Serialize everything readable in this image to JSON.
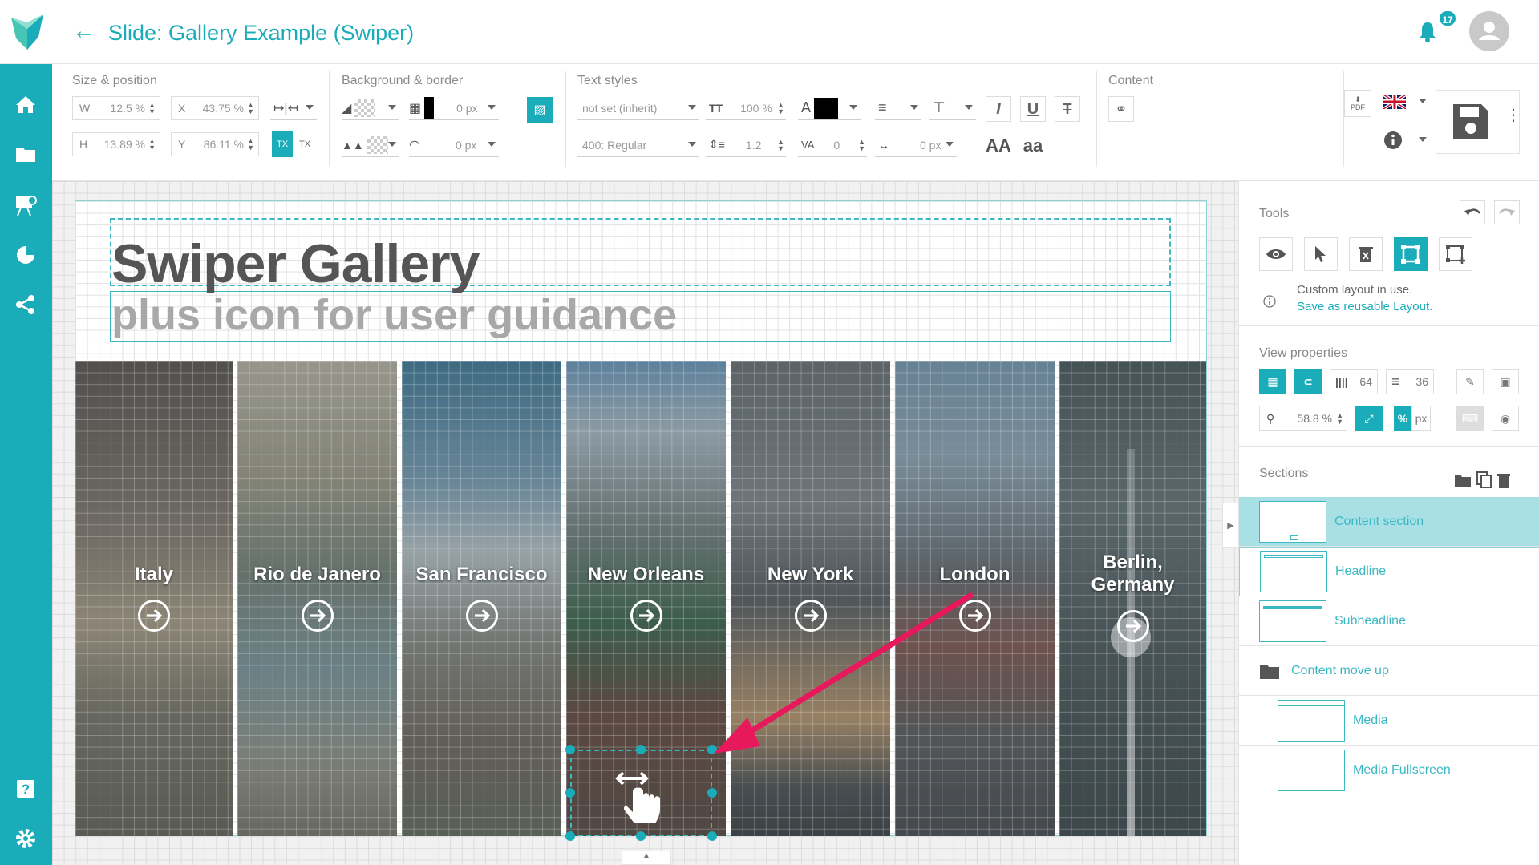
{
  "header": {
    "title": "Slide: Gallery Example (Swiper)",
    "notification_count": "17",
    "colors": {
      "accent": "#1aacb9"
    }
  },
  "sidebar": {
    "items": [
      {
        "name": "home-icon"
      },
      {
        "name": "folder-icon"
      },
      {
        "name": "presentation-icon"
      },
      {
        "name": "pie-chart-icon"
      },
      {
        "name": "share-icon"
      },
      {
        "name": "help-icon"
      },
      {
        "name": "settings-icon"
      }
    ]
  },
  "toolbar": {
    "size_position": {
      "label": "Size & position",
      "w_label": "W",
      "w_value": "12.5 %",
      "x_label": "X",
      "x_value": "43.75 %",
      "h_label": "H",
      "h_value": "13.89 %",
      "y_label": "Y",
      "y_value": "86.11 %"
    },
    "background_border": {
      "label": "Background & border",
      "border_width": "0 px",
      "radius": "0 px"
    },
    "text_styles": {
      "label": "Text styles",
      "font_family": "not set (inherit)",
      "font_weight": "400: Regular",
      "font_size": "100 %",
      "line_height": "1.2",
      "letter_spacing": "0",
      "word_spacing": "0 px",
      "upper_label": "AA",
      "lower_label": "aa",
      "color_label": "A"
    },
    "content": {
      "label": "Content"
    },
    "pdf_label": "PDF"
  },
  "slide": {
    "headline": "Swiper Gallery",
    "subheadline": "plus icon for user guidance",
    "panels": [
      {
        "title": "Italy"
      },
      {
        "title": "Rio de Janero"
      },
      {
        "title": "San Francisco"
      },
      {
        "title": "New Orleans"
      },
      {
        "title": "New York"
      },
      {
        "title": "London"
      },
      {
        "title_line1": "Berlin,",
        "title_line2": "Germany"
      }
    ]
  },
  "right_panel": {
    "tools": {
      "label": "Tools",
      "custom_layout_text": "Custom layout in use.",
      "save_layout_link": "Save as reusable Layout."
    },
    "view_properties": {
      "label": "View properties",
      "columns": "64",
      "rows": "36",
      "zoom": "58.8 %",
      "percent_label": "%",
      "px_label": "px"
    },
    "sections": {
      "label": "Sections",
      "items": [
        {
          "name": "Content section"
        },
        {
          "name": "Headline"
        },
        {
          "name": "Subheadline"
        },
        {
          "name": "Content move up"
        },
        {
          "name": "Media"
        },
        {
          "name": "Media Fullscreen"
        }
      ]
    }
  }
}
